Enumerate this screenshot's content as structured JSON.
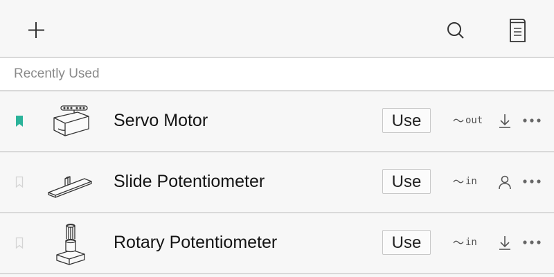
{
  "toolbar": {
    "add_icon": "plus-icon",
    "search_icon": "search-icon",
    "notebook_icon": "notebook-icon"
  },
  "section": {
    "title": "Recently Used"
  },
  "colors": {
    "bookmark_active": "#2bb39a",
    "bookmark_inactive": "#d4d4d4",
    "divider": "#d9d9d9"
  },
  "parts": [
    {
      "name": "Servo Motor",
      "use_label": "Use",
      "io": "out",
      "bookmarked": true,
      "action_icon": "download-icon"
    },
    {
      "name": "Slide Potentiometer",
      "use_label": "Use",
      "io": "in",
      "bookmarked": false,
      "action_icon": "person-icon"
    },
    {
      "name": "Rotary Potentiometer",
      "use_label": "Use",
      "io": "in",
      "bookmarked": false,
      "action_icon": "download-icon"
    }
  ]
}
